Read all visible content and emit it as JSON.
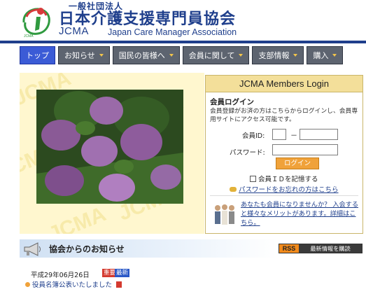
{
  "header": {
    "org_small": "一般社団法人",
    "org_name": "日本介護支援専門員協会",
    "org_abbr": "JCMA",
    "org_en": "Japan Care Manager Association"
  },
  "nav": {
    "items": [
      {
        "label": "トップ",
        "active": true,
        "dropdown": false
      },
      {
        "label": "お知らせ",
        "dropdown": true
      },
      {
        "label": "国民の皆様へ",
        "dropdown": true
      },
      {
        "label": "会員に関して",
        "dropdown": true
      },
      {
        "label": "支部情報",
        "dropdown": true
      },
      {
        "label": "購入",
        "dropdown": true
      }
    ]
  },
  "hero": {
    "watermark": "JCMA"
  },
  "login": {
    "title": "JCMA Members Login",
    "heading": "会員ログイン",
    "description": "会員登録がお済の方はこちらからログインし、会員専用サイトにアクセス可能です。",
    "id_label": "会員ID:",
    "id_separator": "－",
    "password_label": "パスワード:",
    "button": "ログイン",
    "remember": "会員ＩＤを記憶する",
    "forgot": "パスワードをお忘れの方はこちら",
    "promo": "あなたも会員になりませんか？ 入会すると様々なメリットがあります。詳細はこちら。"
  },
  "news": {
    "title": "協会からのお知らせ",
    "rss_label": "RSS",
    "rss_text": "最新情報を購読",
    "date": "平成29年06月26日",
    "tag_important": "重要",
    "tag_new": "最新",
    "item": "役員名簿公表いたしました"
  },
  "colors": {
    "brand_blue": "#1f3f8c",
    "nav_active": "#3b5bd6",
    "nav_default": "#5d6470",
    "accent_orange": "#f0a23a"
  }
}
